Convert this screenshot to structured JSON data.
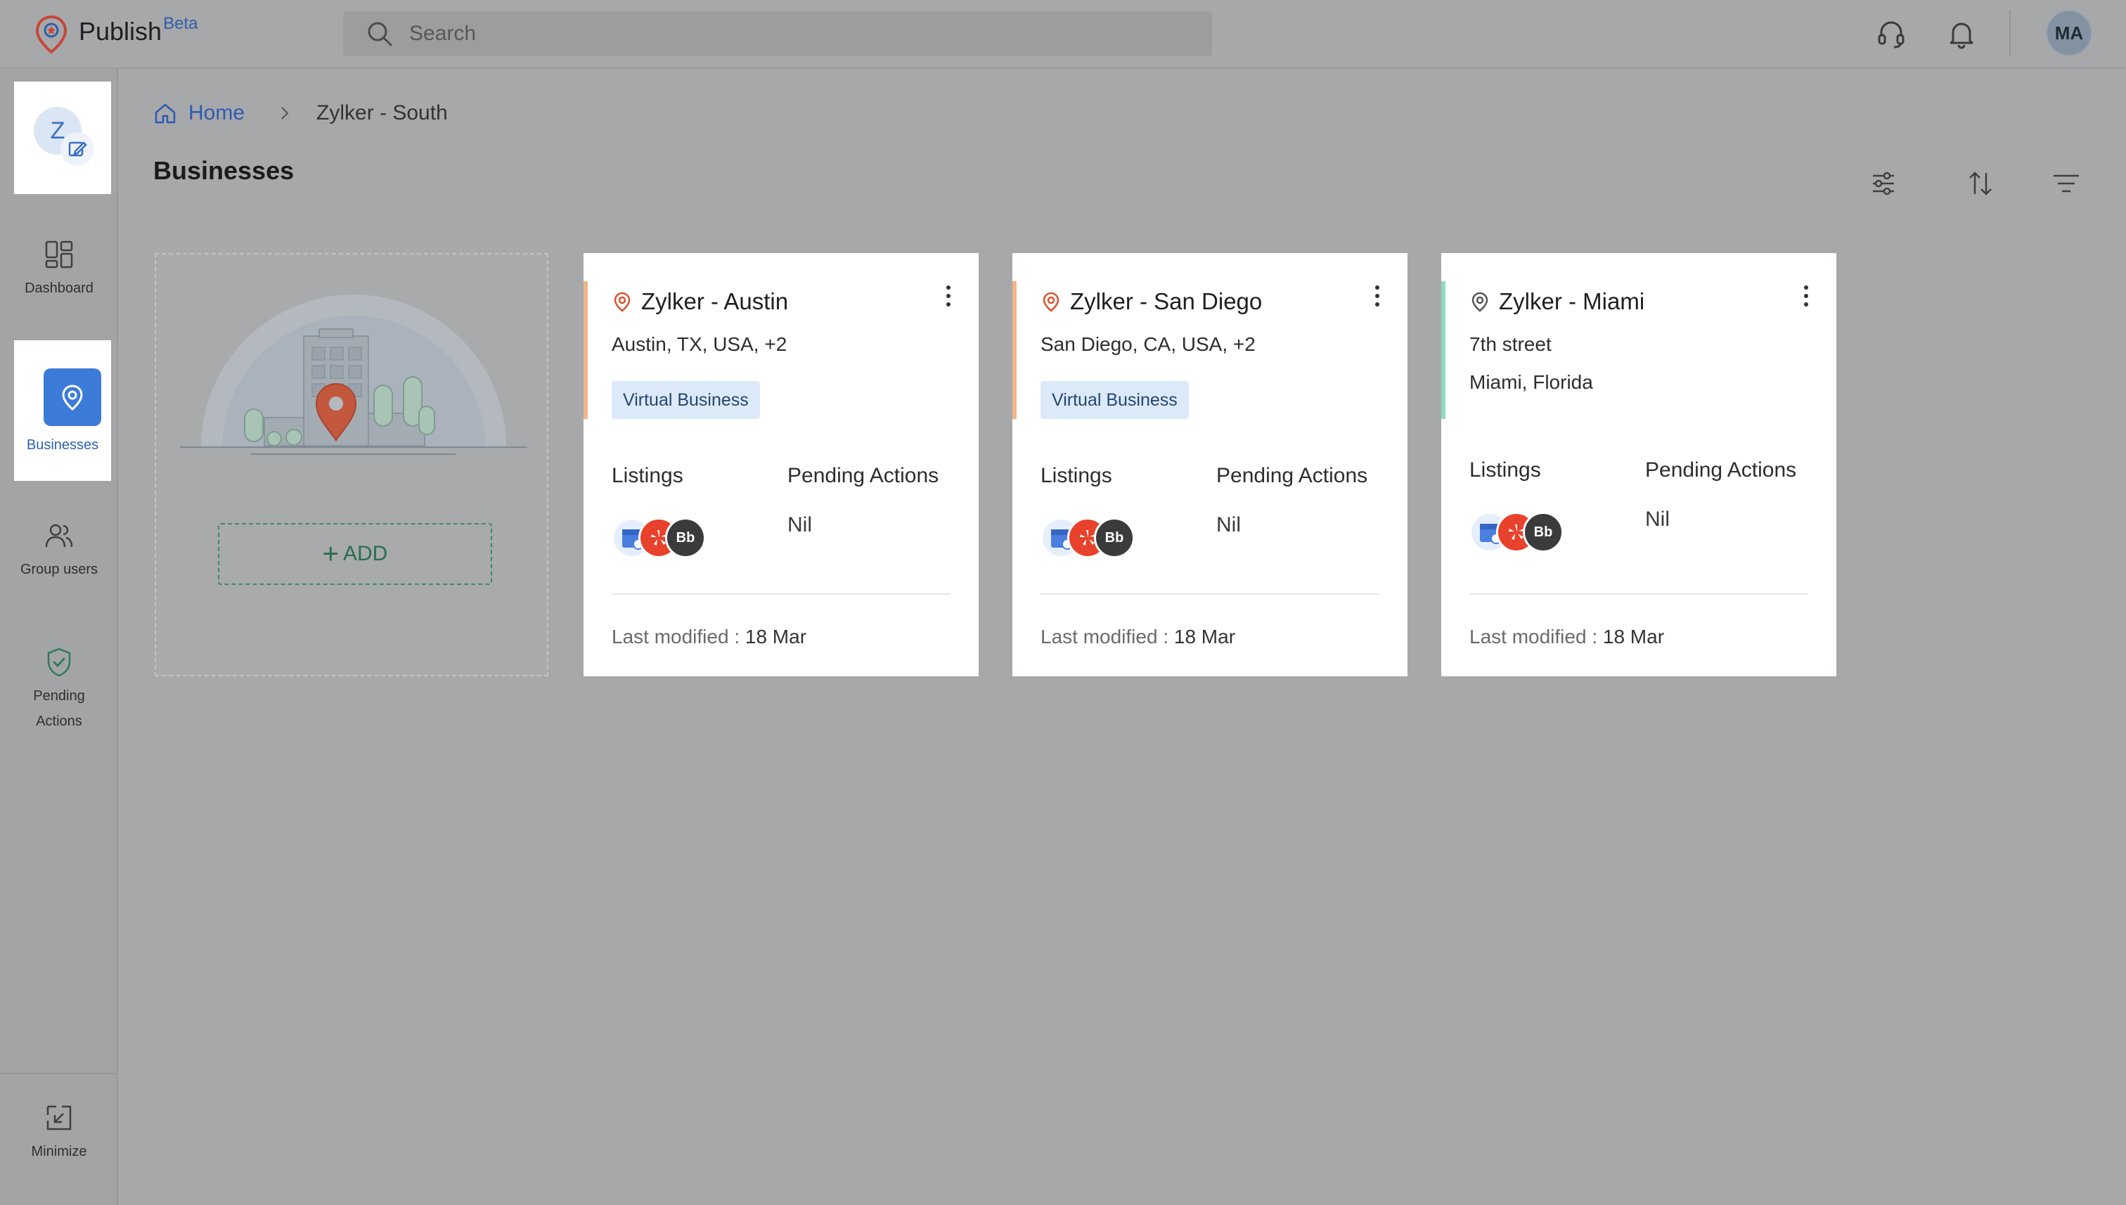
{
  "app": {
    "name": "Publish",
    "badge": "Beta"
  },
  "search": {
    "placeholder": "Search"
  },
  "header": {
    "user_initials": "MA"
  },
  "sidebar": {
    "org_initial": "Z",
    "items": [
      {
        "label": "Dashboard"
      },
      {
        "label": "Businesses"
      },
      {
        "label": "Group users"
      },
      {
        "label": "Pending\nActions"
      }
    ],
    "minimize_label": "Minimize"
  },
  "breadcrumb": {
    "home": "Home",
    "current": "Zylker - South"
  },
  "page": {
    "title": "Businesses"
  },
  "add_card": {
    "button_label": "ADD"
  },
  "businesses": [
    {
      "name": "Zylker - Austin",
      "line1": "Austin, TX, USA, +2",
      "line2": "",
      "tag": "Virtual Business",
      "listings_label": "Listings",
      "pending_label": "Pending Actions",
      "pending_value": "Nil",
      "modified_label": "Last modified : ",
      "modified_value": "18 Mar",
      "accent": "#f0b58a",
      "pin_color": "#d9542f"
    },
    {
      "name": "Zylker - San Diego",
      "line1": "San Diego, CA, USA, +2",
      "line2": "",
      "tag": "Virtual Business",
      "listings_label": "Listings",
      "pending_label": "Pending Actions",
      "pending_value": "Nil",
      "modified_label": "Last modified : ",
      "modified_value": "18 Mar",
      "accent": "#f0b58a",
      "pin_color": "#d9542f"
    },
    {
      "name": "Zylker - Miami",
      "line1": "7th street",
      "line2": "Miami, Florida",
      "tag": "",
      "listings_label": "Listings",
      "pending_label": "Pending Actions",
      "pending_value": "Nil",
      "modified_label": "Last modified : ",
      "modified_value": "18 Mar",
      "accent": "#8fd9c3",
      "pin_color": "#555555"
    }
  ],
  "listing_badges": [
    "google-business-icon",
    "yelp-icon",
    "bbb-icon"
  ],
  "colors": {
    "brand": "#2f5ea8",
    "active_nav": "#3d7bd8",
    "add_button": "#2a6e4e"
  }
}
